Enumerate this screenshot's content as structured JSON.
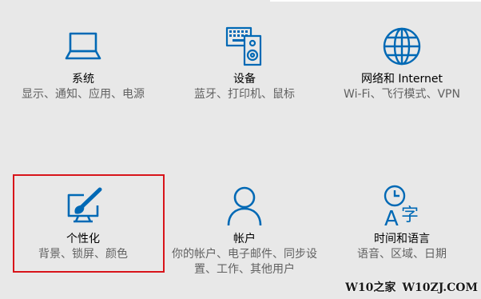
{
  "colors": {
    "background": "#e8e8e8",
    "accent": "#0069b5",
    "highlight": "#d8141a"
  },
  "tiles": [
    {
      "icon": "laptop-icon",
      "title": "系统",
      "desc": "显示、通知、应用、电源"
    },
    {
      "icon": "keyboard-speaker-icon",
      "title": "设备",
      "desc": "蓝牙、打印机、鼠标"
    },
    {
      "icon": "globe-icon",
      "title": "网络和 Internet",
      "desc": "Wi-Fi、飞行模式、VPN"
    },
    {
      "icon": "paintbrush-monitor-icon",
      "title": "个性化",
      "desc": "背景、锁屏、颜色"
    },
    {
      "icon": "person-icon",
      "title": "帐户",
      "desc": "你的帐户、电子邮件、同步设置、工作、其他用户"
    },
    {
      "icon": "clock-language-icon",
      "title": "时间和语言",
      "desc": "语音、区域、日期"
    }
  ],
  "watermark": {
    "left_text": "W10之家",
    "right_text": "W10ZJ.COM"
  }
}
